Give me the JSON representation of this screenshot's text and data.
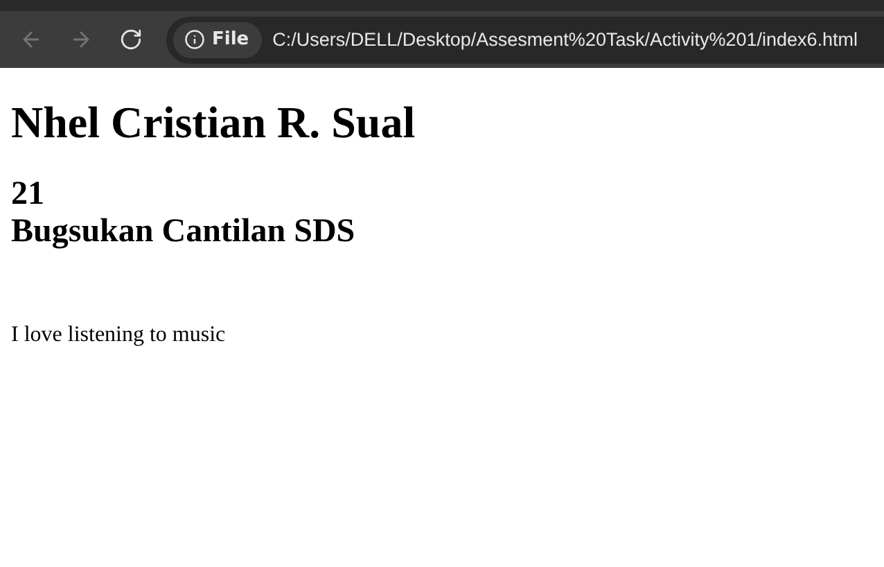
{
  "browser": {
    "nav_buttons": [
      {
        "kind": "back",
        "disabled": true
      },
      {
        "kind": "forward",
        "disabled": true
      },
      {
        "kind": "reload",
        "disabled": false
      }
    ],
    "address_bar": {
      "scheme_chip": "File",
      "url": "C:/Users/DELL/Desktop/Assesment%20Task/Activity%201/index6.html"
    }
  },
  "page": {
    "heading": "Nhel Cristian R. Sual",
    "subheading_lines": [
      "21",
      "Bugsukan Cantilan SDS"
    ],
    "paragraph": "I love listening to music"
  }
}
